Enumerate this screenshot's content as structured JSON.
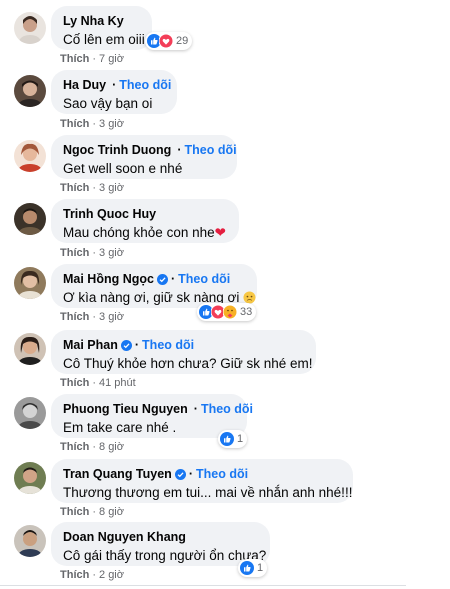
{
  "colors": {
    "link": "#1877f2",
    "bubble": "#f0f2f5",
    "muted": "#65676b",
    "like_blue": "#1877f2",
    "love_red": "#f33e58",
    "care_yellow": "#f7b125"
  },
  "comments": [
    {
      "name": "Ly Nha Ky",
      "verified": false,
      "follow": "",
      "text": "Cố lên em oiii",
      "like": "Thích",
      "time": "7 giờ",
      "reactions": [
        "like-icon",
        "love-icon"
      ],
      "reaction_count": "29"
    },
    {
      "name": "Ha Duy",
      "verified": true,
      "follow": "Theo dõi",
      "text": "Sao vậy bạn oi",
      "like": "Thích",
      "time": "3 giờ",
      "reactions": [],
      "reaction_count": ""
    },
    {
      "name": "Ngoc Trinh Duong",
      "verified": true,
      "follow": "Theo dõi",
      "text": "Get well soon e nhé",
      "like": "Thích",
      "time": "3 giờ",
      "reactions": [],
      "reaction_count": ""
    },
    {
      "name": "Trinh Quoc Huy",
      "verified": false,
      "follow": "",
      "text": "Mau chóng khỏe con nhe",
      "like": "Thích",
      "time": "3 giờ",
      "reactions": [],
      "reaction_count": ""
    },
    {
      "name": "Mai Hồng Ngọc",
      "verified": true,
      "follow": "Theo dõi",
      "text": "Ơ kìa nàng ơi, giữ sk nàng ơi",
      "like": "Thích",
      "time": "3 giờ",
      "reactions": [
        "like-icon",
        "love-icon",
        "care-icon"
      ],
      "reaction_count": "33"
    },
    {
      "name": "Mai Phan",
      "verified": true,
      "follow": "Theo dõi",
      "text": "Cô Thuý khỏe hơn chưa? Giữ sk nhé em!",
      "like": "Thích",
      "time": "41 phút",
      "reactions": [],
      "reaction_count": ""
    },
    {
      "name": "Phuong Tieu Nguyen",
      "verified": true,
      "follow": "Theo dõi",
      "text": "Em take care nhé .",
      "like": "Thích",
      "time": "8 giờ",
      "reactions": [
        "like-icon"
      ],
      "reaction_count": "1"
    },
    {
      "name": "Tran Quang Tuyen",
      "verified": true,
      "follow": "Theo dõi",
      "text": "Thương thương em tui... mai về nhắn anh nhé!!!",
      "like": "Thích",
      "time": "8 giờ",
      "reactions": [],
      "reaction_count": ""
    },
    {
      "name": "Doan Nguyen Khang",
      "verified": false,
      "follow": "",
      "text": "Cô gái thấy trong người ổn chưa?",
      "like": "Thích",
      "time": "2 giờ",
      "reactions": [
        "like-icon"
      ],
      "reaction_count": "1"
    }
  ]
}
